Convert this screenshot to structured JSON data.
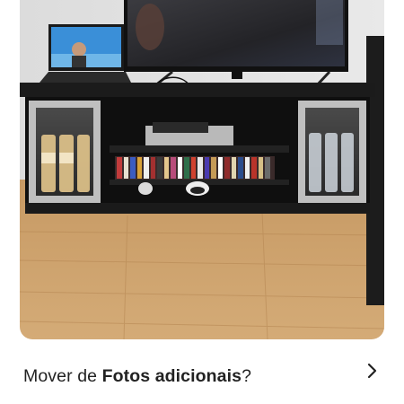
{
  "photo": {
    "alt": "Foto da estante de TV"
  },
  "move_prompt": {
    "prefix": "Mover de ",
    "album": "Fotos adicionais",
    "suffix": "?"
  },
  "icons": {
    "chevron": "chevron-right-icon"
  }
}
